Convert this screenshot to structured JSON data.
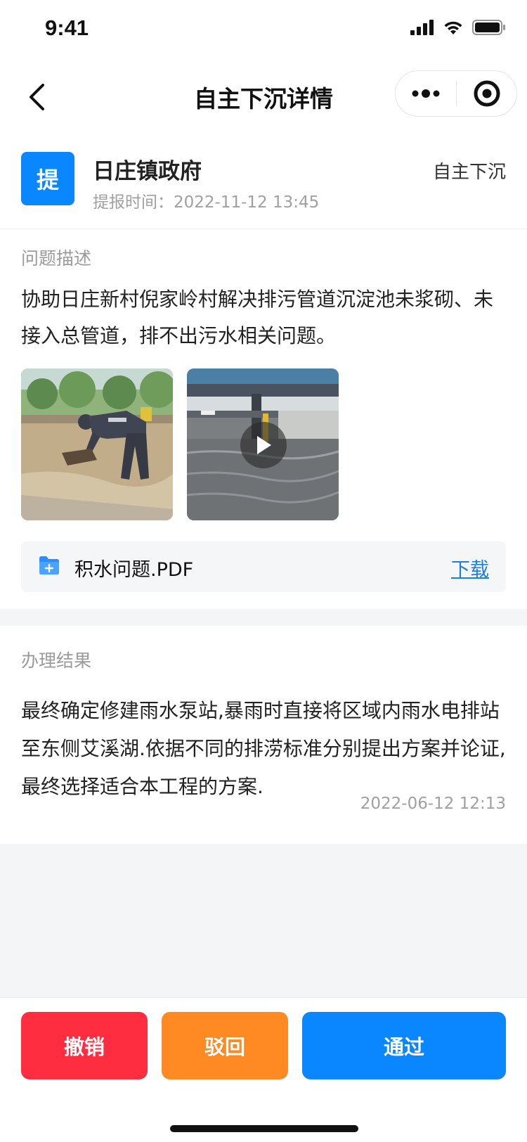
{
  "status_bar": {
    "time": "9:41"
  },
  "nav": {
    "title": "自主下沉详情"
  },
  "header": {
    "avatar_char": "提",
    "org_name": "日庄镇政府",
    "report_time": "提报时间：2022-11-12 13:45",
    "type_tag": "自主下沉"
  },
  "description": {
    "label": "问题描述",
    "text": "协助日庄新村倪家岭村解决排污管道沉淀池未浆砌、未接入总管道，排不出污水相关问题。",
    "media": [
      {
        "kind": "image",
        "icon": "photo-worker-flood"
      },
      {
        "kind": "video",
        "icon": "video-flooded-underpass"
      }
    ],
    "file": {
      "name": "积水问题.PDF",
      "action": "下载",
      "icon": "folder-add-icon"
    }
  },
  "result": {
    "label": "办理结果",
    "text": "最终确定修建雨水泵站,暴雨时直接将区域内雨水电排站至东侧艾溪湖.依据不同的排涝标准分别提出方案并论证,最终选择适合本工程的方案.",
    "time": "2022-06-12 12:13"
  },
  "actions": {
    "cancel": "撤销",
    "reject": "驳回",
    "pass": "通过"
  },
  "colors": {
    "primary": "#0a86ff",
    "danger": "#ff2d3f",
    "warning": "#ff8a23",
    "link": "#1a7fe0"
  }
}
